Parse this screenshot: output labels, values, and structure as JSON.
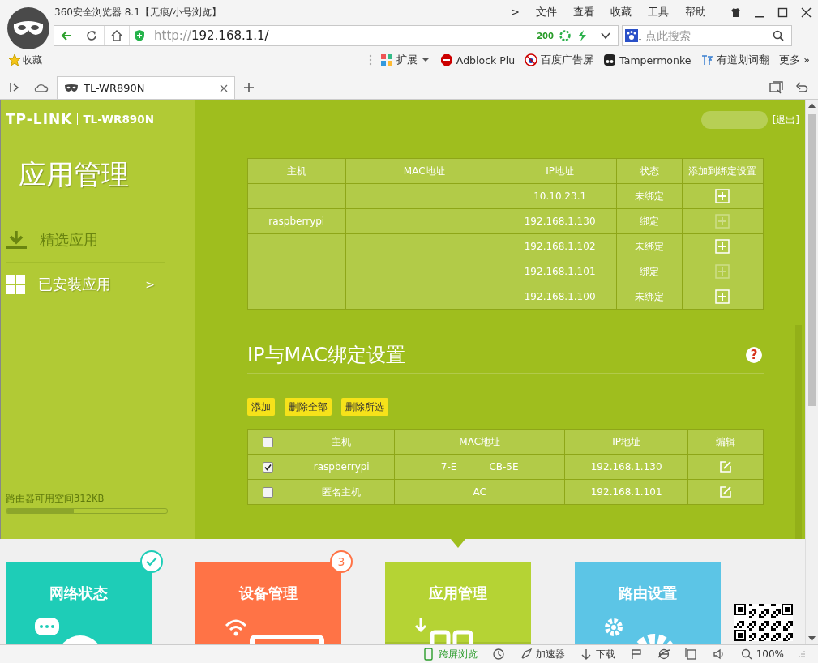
{
  "browser": {
    "title": "360安全浏览器 8.1【无痕/小号浏览】",
    "menu": [
      ">",
      "文件",
      "查看",
      "收藏",
      "工具",
      "帮助"
    ],
    "address": {
      "scheme": "http://",
      "host": "192.168.1.1/",
      "badge": "200"
    },
    "search": {
      "placeholder": "点此搜索"
    },
    "favorites": "收藏",
    "extensions": [
      {
        "kind": "grid",
        "label": "扩展",
        "dropdown": true
      },
      {
        "kind": "abp",
        "label": "Adblock Plu",
        "dropdown": false
      },
      {
        "kind": "baidu",
        "label": "百度广告屏",
        "dropdown": false
      },
      {
        "kind": "tamper",
        "label": "Tampermonke",
        "dropdown": false
      },
      {
        "kind": "youdao",
        "label": "有道划词翻",
        "dropdown": false
      }
    ],
    "more": "更多 »",
    "tabs": [
      {
        "label": "TL-WR890N",
        "selected": true
      }
    ]
  },
  "router": {
    "brand": "TP-LINK",
    "model": "TL-WR890N",
    "user_action": "[退出]",
    "page_title": "应用管理",
    "nav": [
      {
        "kind": "download",
        "label": "精选应用",
        "selected": false
      },
      {
        "kind": "apps",
        "label": "已安装应用",
        "selected": true,
        "arrow": ">"
      }
    ],
    "storage": {
      "text": "路由器可用空间312KB",
      "level": 0.42
    }
  },
  "host_table": {
    "columns": [
      "主机",
      "MAC地址",
      "IP地址",
      "状态",
      "添加到绑定设置"
    ],
    "rows": [
      {
        "ip": "10.10.23.1",
        "status": "未绑定",
        "add_disabled": false
      },
      {
        "host": "raspberrypi",
        "ip": "192.168.1.130",
        "status": "绑定",
        "add_disabled": true
      },
      {
        "ip": "192.168.1.102",
        "status": "未绑定",
        "add_disabled": false
      },
      {
        "ip": "192.168.1.101",
        "status": "绑定",
        "add_disabled": true
      },
      {
        "ip": "192.168.1.100",
        "status": "未绑定",
        "add_disabled": false
      }
    ]
  },
  "binding": {
    "title": "IP与MAC绑定设置",
    "help": "?",
    "buttons": [
      "添加",
      "删除全部",
      "删除所选"
    ],
    "columns": [
      "主机",
      "MAC地址",
      "IP地址",
      "编辑"
    ],
    "select_all": {
      "checked": false
    },
    "rows": [
      {
        "checked": true,
        "host": "raspberrypi",
        "mac": [
          "7-E",
          "CB-5E"
        ],
        "ip": "192.168.1.130"
      },
      {
        "checked": false,
        "host": "匿名主机",
        "mac": [
          "AC"
        ],
        "ip": "192.168.1.101"
      }
    ]
  },
  "tiles": [
    {
      "kind": "network",
      "label": "网络状态",
      "color": "#1ecdb7",
      "badge": {
        "kind": "check"
      },
      "selected": false
    },
    {
      "kind": "devices",
      "label": "设备管理",
      "color": "#ff7346",
      "badge": {
        "kind": "count",
        "text": "3"
      },
      "selected": false
    },
    {
      "kind": "apps",
      "label": "应用管理",
      "color": "#b5d334",
      "selected": true
    },
    {
      "kind": "settings",
      "label": "路由设置",
      "color": "#5cc5e6",
      "selected": false
    }
  ],
  "status_bar": [
    {
      "kind": "phone",
      "label": "跨屏浏览",
      "accent": true
    },
    {
      "kind": "clock"
    },
    {
      "kind": "rocket",
      "label": "加速器",
      "accent": false
    },
    {
      "kind": "down",
      "label": "下载",
      "accent": false
    },
    {
      "kind": "flag"
    },
    {
      "kind": "ie"
    },
    {
      "kind": "window"
    },
    {
      "kind": "sound"
    },
    {
      "kind": "zoom",
      "label": "100%",
      "accent": false
    }
  ]
}
